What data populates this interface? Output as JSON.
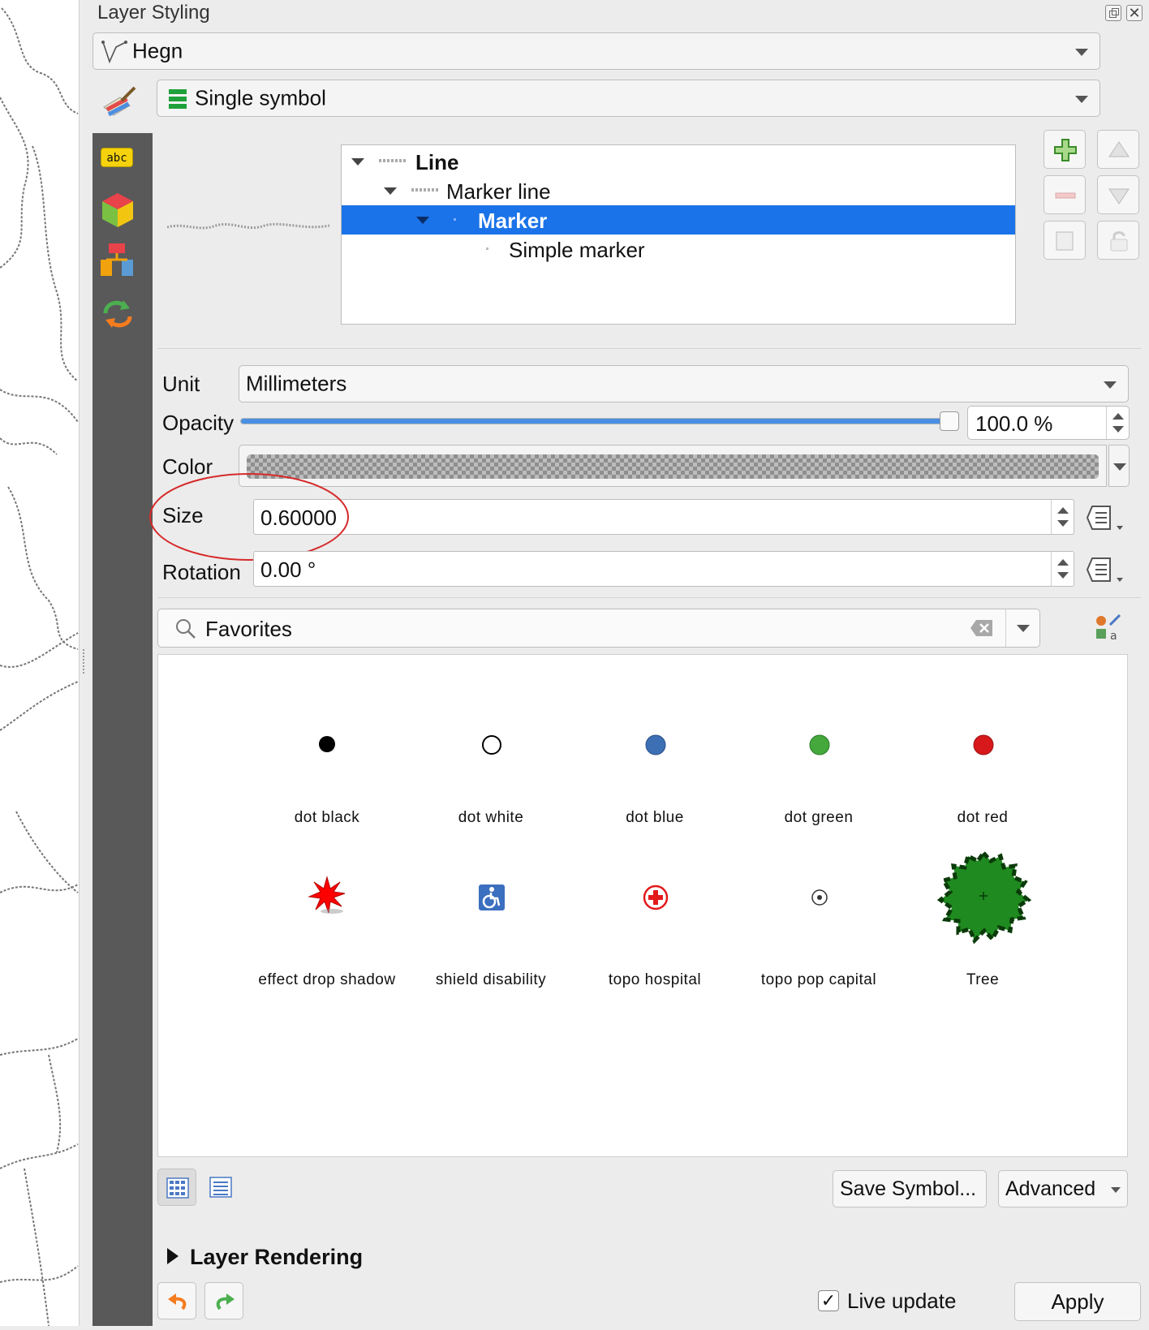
{
  "window": {
    "title": "Layer Styling"
  },
  "layer_select": {
    "value": "Hegn"
  },
  "renderer_select": {
    "value": "Single symbol"
  },
  "sidebar": {
    "items": [
      "labels-icon",
      "3d-view-icon",
      "diagrams-icon",
      "history-icon"
    ]
  },
  "symbol_tree": {
    "items": [
      {
        "label": "Line",
        "level": 0,
        "bold": true,
        "selected": false
      },
      {
        "label": "Marker line",
        "level": 1,
        "bold": false,
        "selected": false
      },
      {
        "label": "Marker",
        "level": 2,
        "bold": true,
        "selected": true
      },
      {
        "label": "Simple marker",
        "level": 3,
        "bold": false,
        "selected": false
      }
    ]
  },
  "properties": {
    "unit_label": "Unit",
    "unit_value": "Millimeters",
    "opacity_label": "Opacity",
    "opacity_value": "100.0 %",
    "opacity_fraction": 1.0,
    "color_label": "Color",
    "size_label": "Size",
    "size_value": "0.60000",
    "rotation_label": "Rotation",
    "rotation_value": "0.00 °"
  },
  "library": {
    "search_value": "Favorites",
    "symbols": [
      {
        "label": "dot  black",
        "icon": "dot-black",
        "color": "#000000"
      },
      {
        "label": "dot  white",
        "icon": "dot-white",
        "color": "#ffffff"
      },
      {
        "label": "dot blue",
        "icon": "dot-blue",
        "color": "#3d6fb4"
      },
      {
        "label": "dot green",
        "icon": "dot-green",
        "color": "#44a83d"
      },
      {
        "label": "dot red",
        "icon": "dot-red",
        "color": "#d7191c"
      },
      {
        "label": "effect drop shadow",
        "icon": "star-burst-red",
        "color": "#ff0000"
      },
      {
        "label": "shield disability",
        "icon": "wheelchair-shield",
        "color": "#3b6fbf"
      },
      {
        "label": "topo hospital",
        "icon": "hospital-cross",
        "color": "#e31a1c"
      },
      {
        "label": "topo pop capital",
        "icon": "circle-dot",
        "color": "#333333"
      },
      {
        "label": "Tree",
        "icon": "tree-blob",
        "color": "#1f8a1f"
      }
    ]
  },
  "buttons": {
    "save_symbol": "Save Symbol...",
    "advanced": "Advanced",
    "layer_rendering": "Layer Rendering",
    "live_update": "Live update",
    "apply": "Apply"
  },
  "colors": {
    "selection": "#1a73e8",
    "sidebar": "#595959",
    "annotation": "#d62b2b"
  }
}
